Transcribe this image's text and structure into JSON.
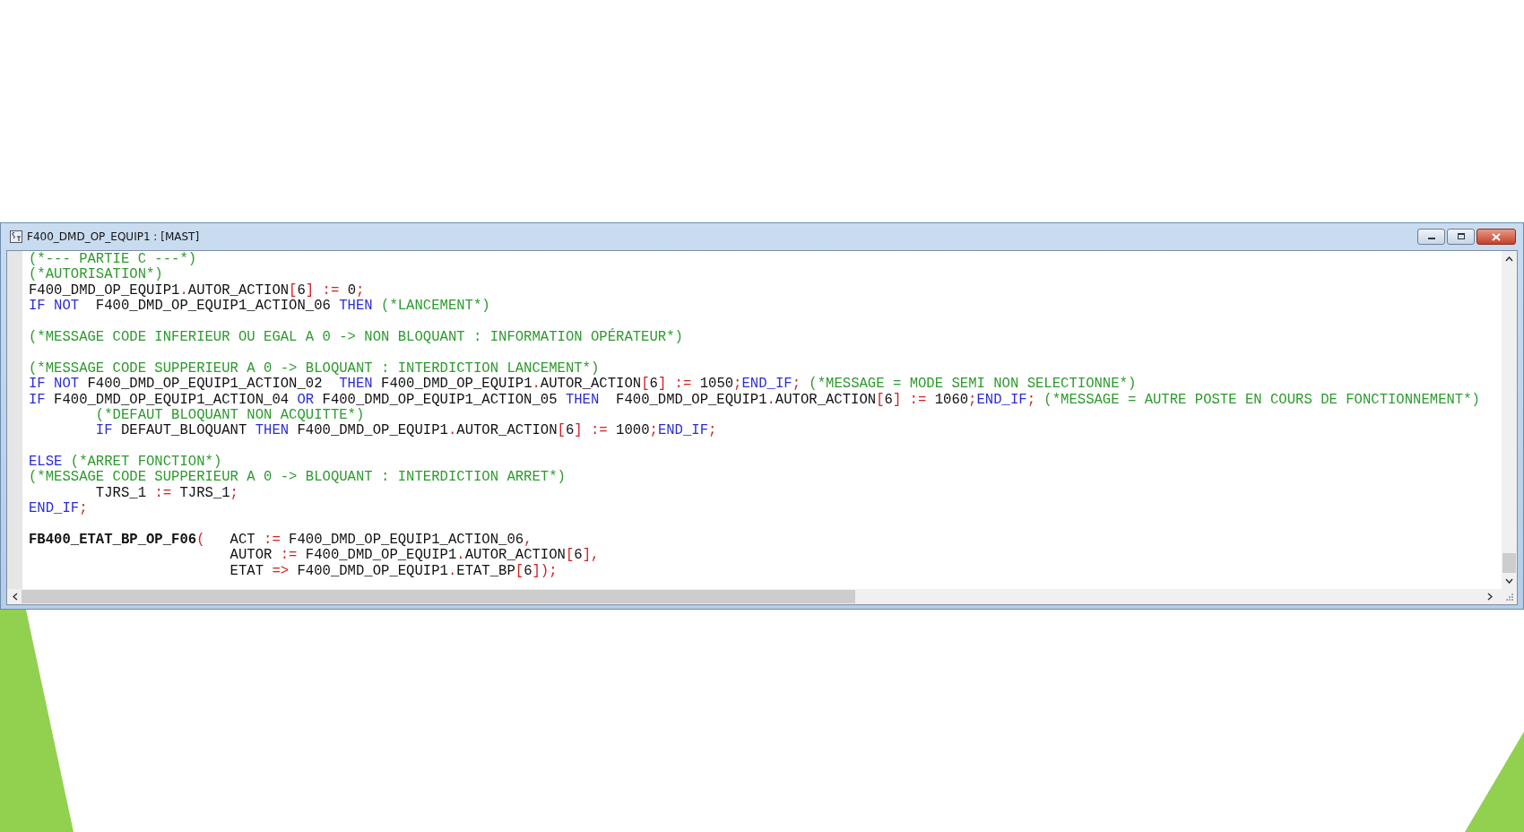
{
  "window": {
    "title": "F400_DMD_OP_EQUIP1 : [MAST]"
  },
  "code_lines": [
    {
      "kind": "code",
      "tokens": [
        {
          "kind": "comment",
          "text": "(*--- PARTIE C ---*)"
        }
      ]
    },
    {
      "kind": "code",
      "tokens": [
        {
          "kind": "comment",
          "text": "(*AUTORISATION*)"
        }
      ]
    },
    {
      "kind": "code",
      "tokens": [
        {
          "kind": "ident",
          "text": "F400_DMD_OP_EQUIP1"
        },
        {
          "kind": "op",
          "text": "."
        },
        {
          "kind": "ident",
          "text": "AUTOR_ACTION"
        },
        {
          "kind": "op",
          "text": "["
        },
        {
          "kind": "ident",
          "text": "6"
        },
        {
          "kind": "op",
          "text": "] := "
        },
        {
          "kind": "ident",
          "text": "0"
        },
        {
          "kind": "op",
          "text": ";"
        }
      ]
    },
    {
      "kind": "code",
      "tokens": [
        {
          "kind": "keyword",
          "text": "IF NOT"
        },
        {
          "kind": "ident",
          "text": "  F400_DMD_OP_EQUIP1_ACTION_06 "
        },
        {
          "kind": "keyword",
          "text": "THEN"
        },
        {
          "kind": "comment",
          "text": " (*LANCEMENT*)"
        }
      ]
    },
    {
      "kind": "blank"
    },
    {
      "kind": "code",
      "tokens": [
        {
          "kind": "comment",
          "text": "(*MESSAGE CODE INFERIEUR OU EGAL A 0 -> NON BLOQUANT : INFORMATION OPÉRATEUR*)"
        }
      ]
    },
    {
      "kind": "blank"
    },
    {
      "kind": "code",
      "tokens": [
        {
          "kind": "comment",
          "text": "(*MESSAGE CODE SUPPERIEUR A 0 -> BLOQUANT : INTERDICTION LANCEMENT*)"
        }
      ]
    },
    {
      "kind": "code",
      "tokens": [
        {
          "kind": "keyword",
          "text": "IF NOT"
        },
        {
          "kind": "ident",
          "text": " F400_DMD_OP_EQUIP1_ACTION_02  "
        },
        {
          "kind": "keyword",
          "text": "THEN"
        },
        {
          "kind": "ident",
          "text": " F400_DMD_OP_EQUIP1"
        },
        {
          "kind": "op",
          "text": "."
        },
        {
          "kind": "ident",
          "text": "AUTOR_ACTION"
        },
        {
          "kind": "op",
          "text": "["
        },
        {
          "kind": "ident",
          "text": "6"
        },
        {
          "kind": "op",
          "text": "] := "
        },
        {
          "kind": "ident",
          "text": "1050"
        },
        {
          "kind": "op",
          "text": ";"
        },
        {
          "kind": "keyword",
          "text": "END_IF"
        },
        {
          "kind": "op",
          "text": ";"
        },
        {
          "kind": "comment",
          "text": " (*MESSAGE = MODE SEMI NON SELECTIONNE*)"
        }
      ]
    },
    {
      "kind": "code",
      "tokens": [
        {
          "kind": "keyword",
          "text": "IF"
        },
        {
          "kind": "ident",
          "text": " F400_DMD_OP_EQUIP1_ACTION_04 "
        },
        {
          "kind": "keyword",
          "text": "OR"
        },
        {
          "kind": "ident",
          "text": " F400_DMD_OP_EQUIP1_ACTION_05 "
        },
        {
          "kind": "keyword",
          "text": "THEN"
        },
        {
          "kind": "ident",
          "text": "  F400_DMD_OP_EQUIP1"
        },
        {
          "kind": "op",
          "text": "."
        },
        {
          "kind": "ident",
          "text": "AUTOR_ACTION"
        },
        {
          "kind": "op",
          "text": "["
        },
        {
          "kind": "ident",
          "text": "6"
        },
        {
          "kind": "op",
          "text": "] := "
        },
        {
          "kind": "ident",
          "text": "1060"
        },
        {
          "kind": "op",
          "text": ";"
        },
        {
          "kind": "keyword",
          "text": "END_IF"
        },
        {
          "kind": "op",
          "text": ";"
        },
        {
          "kind": "comment",
          "text": " (*MESSAGE = AUTRE POSTE EN COURS DE FONCTIONNEMENT*)"
        }
      ]
    },
    {
      "kind": "code",
      "tokens": [
        {
          "kind": "comment",
          "text": "        (*DEFAUT BLOQUANT NON ACQUITTE*)"
        }
      ]
    },
    {
      "kind": "code",
      "tokens": [
        {
          "kind": "keyword",
          "text": "        IF"
        },
        {
          "kind": "ident",
          "text": " DEFAUT_BLOQUANT "
        },
        {
          "kind": "keyword",
          "text": "THEN"
        },
        {
          "kind": "ident",
          "text": " F400_DMD_OP_EQUIP1"
        },
        {
          "kind": "op",
          "text": "."
        },
        {
          "kind": "ident",
          "text": "AUTOR_ACTION"
        },
        {
          "kind": "op",
          "text": "["
        },
        {
          "kind": "ident",
          "text": "6"
        },
        {
          "kind": "op",
          "text": "] := "
        },
        {
          "kind": "ident",
          "text": "1000"
        },
        {
          "kind": "op",
          "text": ";"
        },
        {
          "kind": "keyword",
          "text": "END_IF"
        },
        {
          "kind": "op",
          "text": ";"
        }
      ]
    },
    {
      "kind": "blank"
    },
    {
      "kind": "code",
      "tokens": [
        {
          "kind": "keyword",
          "text": "ELSE"
        },
        {
          "kind": "comment",
          "text": " (*ARRET FONCTION*)"
        }
      ]
    },
    {
      "kind": "code",
      "tokens": [
        {
          "kind": "comment",
          "text": "(*MESSAGE CODE SUPPERIEUR A 0 -> BLOQUANT : INTERDICTION ARRET*)"
        }
      ]
    },
    {
      "kind": "code",
      "tokens": [
        {
          "kind": "ident",
          "text": "        TJRS_1 "
        },
        {
          "kind": "op",
          "text": ":="
        },
        {
          "kind": "ident",
          "text": " TJRS_1"
        },
        {
          "kind": "op",
          "text": ";"
        }
      ]
    },
    {
      "kind": "code",
      "tokens": [
        {
          "kind": "keyword",
          "text": "END_IF"
        },
        {
          "kind": "op",
          "text": ";"
        }
      ]
    },
    {
      "kind": "blank"
    },
    {
      "kind": "code",
      "tokens": [
        {
          "kind": "block",
          "text": "FB400_ETAT_BP_OP_F06"
        },
        {
          "kind": "op",
          "text": "("
        },
        {
          "kind": "ident",
          "text": "   ACT "
        },
        {
          "kind": "op",
          "text": ":="
        },
        {
          "kind": "ident",
          "text": " F400_DMD_OP_EQUIP1_ACTION_06"
        },
        {
          "kind": "op",
          "text": ","
        }
      ]
    },
    {
      "kind": "code",
      "tokens": [
        {
          "kind": "ident",
          "text": "                        AUTOR "
        },
        {
          "kind": "op",
          "text": ":="
        },
        {
          "kind": "ident",
          "text": " F400_DMD_OP_EQUIP1"
        },
        {
          "kind": "op",
          "text": "."
        },
        {
          "kind": "ident",
          "text": "AUTOR_ACTION"
        },
        {
          "kind": "op",
          "text": "["
        },
        {
          "kind": "ident",
          "text": "6"
        },
        {
          "kind": "op",
          "text": "],"
        }
      ]
    },
    {
      "kind": "code",
      "tokens": [
        {
          "kind": "ident",
          "text": "                        ETAT "
        },
        {
          "kind": "op",
          "text": "=>"
        },
        {
          "kind": "ident",
          "text": " F400_DMD_OP_EQUIP1"
        },
        {
          "kind": "op",
          "text": "."
        },
        {
          "kind": "ident",
          "text": "ETAT_BP"
        },
        {
          "kind": "op",
          "text": "["
        },
        {
          "kind": "ident",
          "text": "6"
        },
        {
          "kind": "op",
          "text": "]);"
        }
      ]
    }
  ]
}
